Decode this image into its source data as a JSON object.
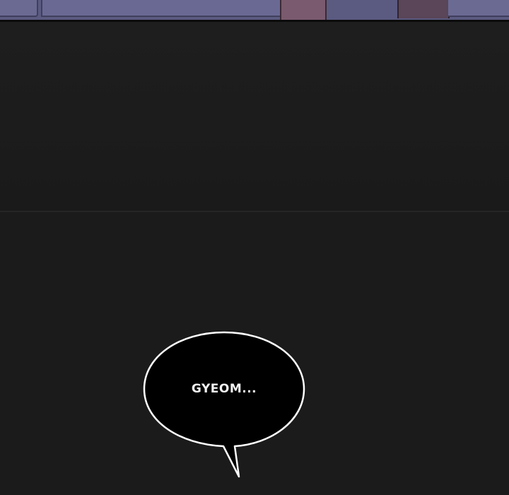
{
  "comic": {
    "dialogue": "GYEOM..."
  },
  "colors": {
    "background": "#1b1b1b",
    "bubble_fill": "#000000",
    "bubble_outline": "#ffffff",
    "text": "#f2f2f2",
    "top_strip": "#5b5a80"
  }
}
